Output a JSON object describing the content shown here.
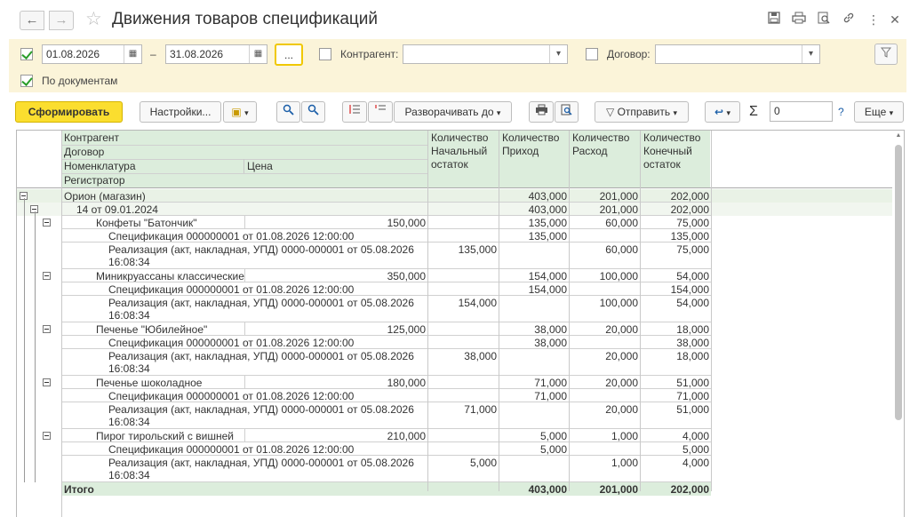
{
  "window": {
    "title": "Движения товаров спецификаций"
  },
  "nav": {
    "back": "←",
    "forward": "→"
  },
  "filters": {
    "period_enabled": true,
    "date_from": "01.08.2026",
    "date_sep": "–",
    "date_to": "31.08.2026",
    "dots": "...",
    "counterparty_label": "Контрагент:",
    "counterparty_value": "",
    "contract_label": "Договор:",
    "contract_value": "",
    "by_documents_label": "По документам",
    "by_documents_checked": true
  },
  "toolbar": {
    "generate": "Сформировать",
    "settings": "Настройки...",
    "expand_to": "Разворачивать до",
    "send": "Отправить",
    "sum_value": "0",
    "help": "?",
    "more": "Еще"
  },
  "table": {
    "headers": {
      "counterparty": "Контрагент",
      "contract": "Договор",
      "nomenclature": "Номенклатура",
      "price": "Цена",
      "registrar": "Регистратор",
      "qty_start": [
        "Количество",
        "Начальный",
        "остаток"
      ],
      "qty_in": [
        "Количество",
        "Приход"
      ],
      "qty_out": [
        "Количество",
        "Расход"
      ],
      "qty_end": [
        "Количество",
        "Конечный",
        "остаток"
      ]
    },
    "rows": [
      {
        "level": 0,
        "name": "Орион (магазин)",
        "price": "",
        "start": "",
        "in": "403,000",
        "out": "201,000",
        "end": "202,000",
        "style": "grp"
      },
      {
        "level": 1,
        "name": "14 от 09.01.2024",
        "price": "",
        "start": "",
        "in": "403,000",
        "out": "201,000",
        "end": "202,000",
        "style": "grp2"
      },
      {
        "level": 2,
        "name": "Конфеты \"Батончик\"",
        "price": "150,000",
        "start": "",
        "in": "135,000",
        "out": "60,000",
        "end": "75,000"
      },
      {
        "level": 3,
        "name": "Спецификация 000000001 от 01.08.2026 12:00:00",
        "price": "",
        "start": "",
        "in": "135,000",
        "out": "",
        "end": "135,000"
      },
      {
        "level": 3,
        "name": "Реализация (акт, накладная, УПД) 0000-000001 от 05.08.2026",
        "name2": "16:08:34",
        "price": "",
        "start": "135,000",
        "in": "",
        "out": "60,000",
        "end": "75,000"
      },
      {
        "level": 2,
        "name": "Миникруассаны классические",
        "price": "350,000",
        "start": "",
        "in": "154,000",
        "out": "100,000",
        "end": "54,000"
      },
      {
        "level": 3,
        "name": "Спецификация 000000001 от 01.08.2026 12:00:00",
        "price": "",
        "start": "",
        "in": "154,000",
        "out": "",
        "end": "154,000"
      },
      {
        "level": 3,
        "name": "Реализация (акт, накладная, УПД) 0000-000001 от 05.08.2026",
        "name2": "16:08:34",
        "price": "",
        "start": "154,000",
        "in": "",
        "out": "100,000",
        "end": "54,000"
      },
      {
        "level": 2,
        "name": "Печенье \"Юбилейное\"",
        "price": "125,000",
        "start": "",
        "in": "38,000",
        "out": "20,000",
        "end": "18,000"
      },
      {
        "level": 3,
        "name": "Спецификация 000000001 от 01.08.2026 12:00:00",
        "price": "",
        "start": "",
        "in": "38,000",
        "out": "",
        "end": "38,000"
      },
      {
        "level": 3,
        "name": "Реализация (акт, накладная, УПД) 0000-000001 от 05.08.2026",
        "name2": "16:08:34",
        "price": "",
        "start": "38,000",
        "in": "",
        "out": "20,000",
        "end": "18,000"
      },
      {
        "level": 2,
        "name": "Печенье шоколадное",
        "price": "180,000",
        "start": "",
        "in": "71,000",
        "out": "20,000",
        "end": "51,000"
      },
      {
        "level": 3,
        "name": "Спецификация 000000001 от 01.08.2026 12:00:00",
        "price": "",
        "start": "",
        "in": "71,000",
        "out": "",
        "end": "71,000"
      },
      {
        "level": 3,
        "name": "Реализация (акт, накладная, УПД) 0000-000001 от 05.08.2026",
        "name2": "16:08:34",
        "price": "",
        "start": "71,000",
        "in": "",
        "out": "20,000",
        "end": "51,000"
      },
      {
        "level": 2,
        "name": "Пирог тирольский с вишней",
        "price": "210,000",
        "start": "",
        "in": "5,000",
        "out": "1,000",
        "end": "4,000"
      },
      {
        "level": 3,
        "name": "Спецификация 000000001 от 01.08.2026 12:00:00",
        "price": "",
        "start": "",
        "in": "5,000",
        "out": "",
        "end": "5,000"
      },
      {
        "level": 3,
        "name": "Реализация (акт, накладная, УПД) 0000-000001 от 05.08.2026",
        "name2": "16:08:34",
        "price": "",
        "start": "5,000",
        "in": "",
        "out": "1,000",
        "end": "4,000"
      }
    ],
    "total": {
      "name": "Итого",
      "start": "",
      "in": "403,000",
      "out": "201,000",
      "end": "202,000"
    }
  },
  "colors": {
    "accent": "#fbde2f",
    "header_bg": "#dceddc",
    "filter_bg": "#fbf4d9",
    "check": "#2a9d2a"
  }
}
